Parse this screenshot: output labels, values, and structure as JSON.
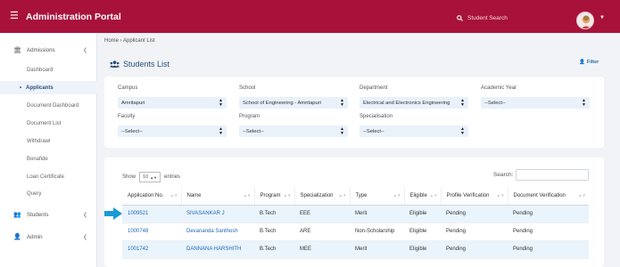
{
  "topbar": {
    "menu_icon": "hamburger-icon",
    "title": "Administration Portal",
    "search_placeholder": "Student Search",
    "brand_color": "#a8123a"
  },
  "sidebar": {
    "group_admissions": "Admissions",
    "items": [
      "Dashboard",
      "Applicants",
      "Document Dashboard",
      "Document List",
      "Withdrawl",
      "Bonafide",
      "Loan Certificate",
      "Query"
    ],
    "active_item": "Applicants",
    "group_students": "Students",
    "group_admin": "Admin"
  },
  "breadcrumb": "Home › Applicant List",
  "page_title": "Students List",
  "filter_button": "Filter",
  "filters": {
    "campus": {
      "label": "Campus",
      "value": "Amritapuri"
    },
    "school": {
      "label": "School",
      "value": "School of Engineering - Amritapuri"
    },
    "department": {
      "label": "Department",
      "value": "Electrical and Electronics Engineering"
    },
    "academic_year": {
      "label": "Academic Year",
      "value": "--Select--"
    },
    "faculty": {
      "label": "Faculty",
      "value": "--Select--"
    },
    "program": {
      "label": "Program",
      "value": "--Select--"
    },
    "specialisation": {
      "label": "Specialisation",
      "value": "--Select--"
    }
  },
  "table": {
    "show_label": "Show",
    "entries_value": "10",
    "entries_label": "entries",
    "search_label": "Search:",
    "columns": [
      "Application No.",
      "Name",
      "Program",
      "Specialization",
      "Type",
      "Eligible",
      "Profile Verification",
      "Document Verification"
    ],
    "rows": [
      [
        "1009521",
        "SIVASANKAR J",
        "B.Tech",
        "EEE",
        "Merit",
        "Eligible",
        "Pending",
        "Pending"
      ],
      [
        "1000748",
        "Devananda Santhosh",
        "B.Tech",
        "ARE",
        "Non-Scholarship",
        "Eligible",
        "Pending",
        "Pending"
      ],
      [
        "1001742",
        "DANNANA HARSHITH",
        "B.Tech",
        "MEE",
        "Merit",
        "Eligible",
        "Pending",
        "Pending"
      ]
    ]
  },
  "colors": {
    "accent": "#2a4f7d",
    "row_stripe": "#eaf4fc",
    "pointer_arrow": "#1a9ad6"
  }
}
